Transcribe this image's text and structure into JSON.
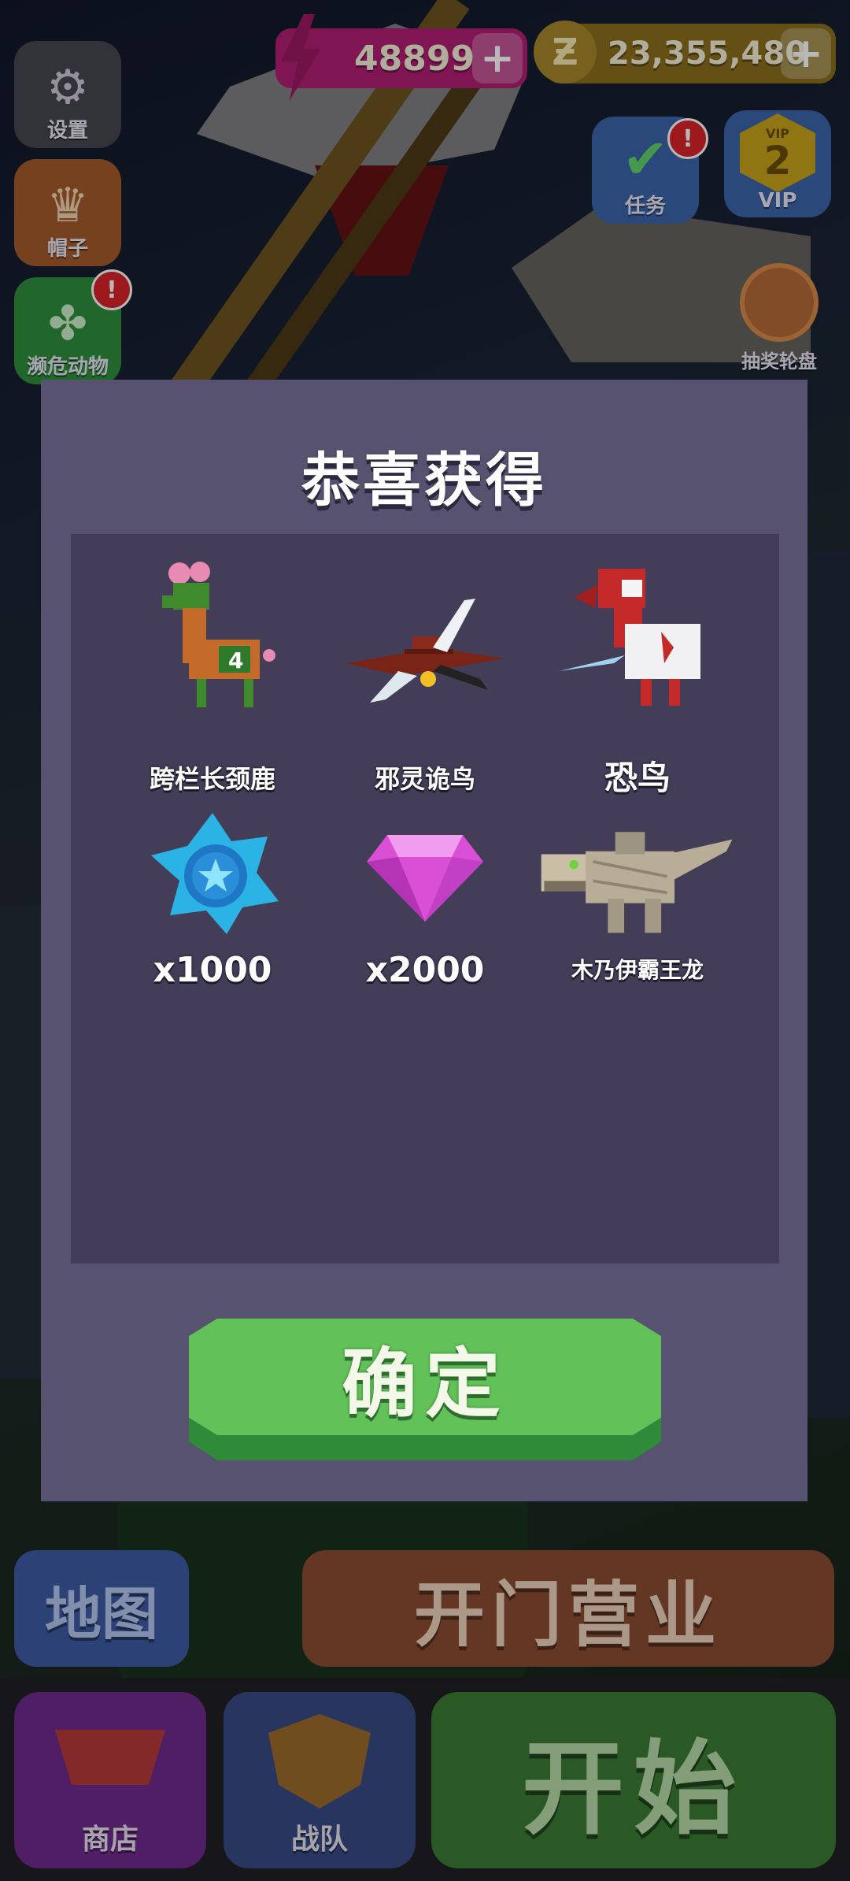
{
  "hud": {
    "settings_label": "设置",
    "hats_label": "帽子",
    "endangered_label": "濒危动物",
    "energy_value": "48899",
    "coins_value": "23,355,480",
    "plus_symbol": "+",
    "task_label": "任务",
    "vip_label": "VIP",
    "vip_badge_text": "VIP",
    "vip_level": "2",
    "wheel_label": "抽奖轮盘",
    "alert_mark": "!"
  },
  "bottom": {
    "map_label": "地图",
    "open_business_label": "开门营业",
    "shop_label": "商店",
    "team_label": "战队",
    "start_label": "开始"
  },
  "dialog": {
    "title": "恭喜获得",
    "rewards": [
      {
        "name": "跨栏长颈鹿",
        "icon": "giraffe-icon"
      },
      {
        "name": "邪灵诡鸟",
        "icon": "evil-bird-icon"
      },
      {
        "name": "恐鸟",
        "icon": "moa-bird-icon"
      },
      {
        "name": "x1000",
        "icon": "blue-star-token-icon"
      },
      {
        "name": "x2000",
        "icon": "pink-gem-icon"
      },
      {
        "name": "木乃伊霸王龙",
        "icon": "mummy-trex-icon"
      }
    ],
    "confirm_label": "确定"
  },
  "colors": {
    "dialog_bg": "#57526f",
    "panel_bg": "#433d57",
    "confirm_green": "#62c159",
    "energy_magenta": "#b01e74",
    "coin_gold": "#8b6f1d"
  }
}
